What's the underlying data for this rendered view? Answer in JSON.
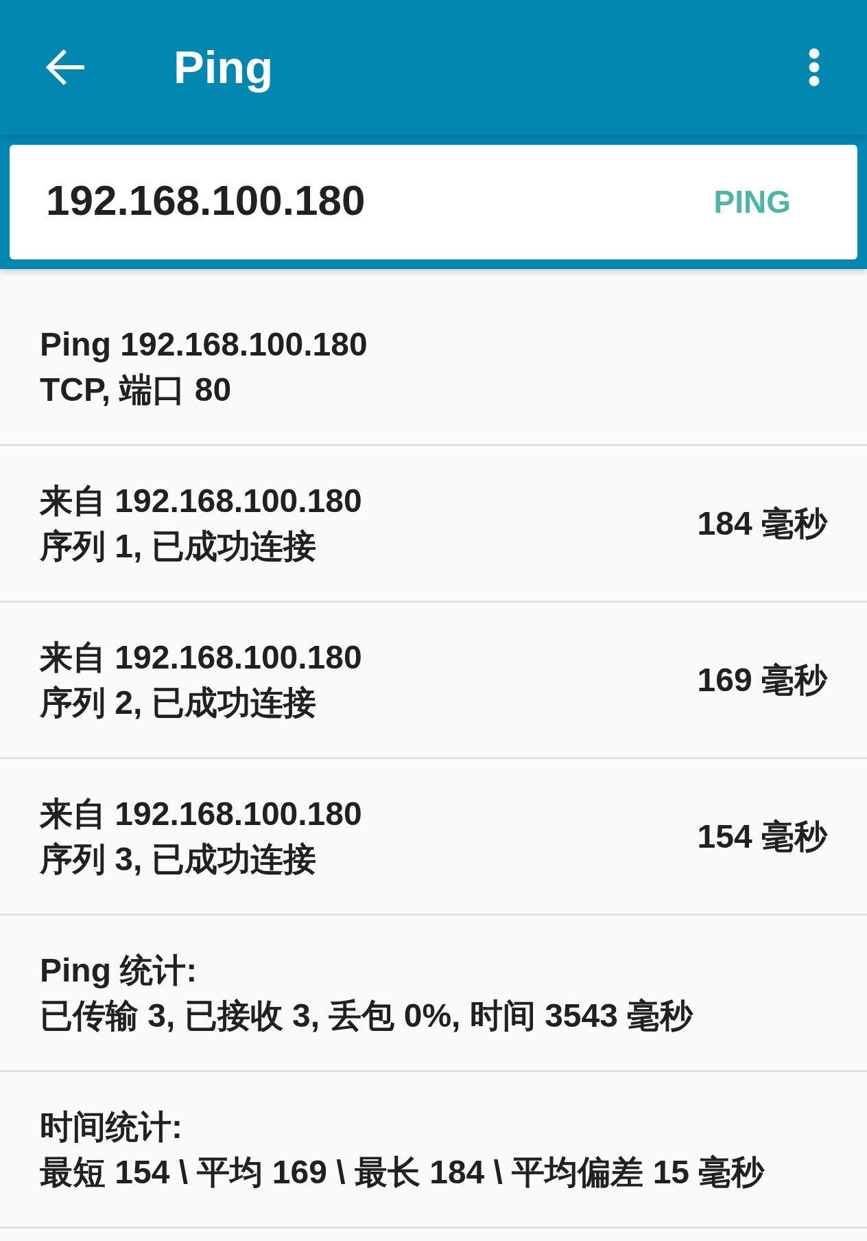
{
  "app_bar": {
    "title": "Ping"
  },
  "host_field": {
    "value": "192.168.100.180"
  },
  "ping_button": {
    "label": "PING"
  },
  "results": [
    {
      "kind": "info",
      "line_1": "Ping 192.168.100.180",
      "line_2": "TCP, 端口 80"
    },
    {
      "kind": "reply",
      "line_1": "来自 192.168.100.180",
      "line_2": "序列 1, 已成功连接",
      "time": "184 毫秒"
    },
    {
      "kind": "reply",
      "line_1": "来自 192.168.100.180",
      "line_2": "序列 2, 已成功连接",
      "time": "169 毫秒"
    },
    {
      "kind": "reply",
      "line_1": "来自 192.168.100.180",
      "line_2": "序列 3, 已成功连接",
      "time": "154 毫秒"
    },
    {
      "kind": "info",
      "line_1": "Ping 统计:",
      "line_2": "已传输 3, 已接收 3, 丢包 0%, 时间 3543 毫秒"
    },
    {
      "kind": "info",
      "line_1": "时间统计:",
      "line_2": "最短 154 \\ 平均 169 \\ 最长 184 \\ 平均偏差 15 毫秒"
    }
  ]
}
